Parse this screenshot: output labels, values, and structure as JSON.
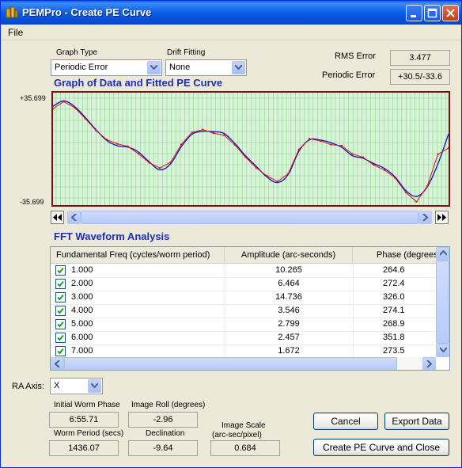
{
  "window": {
    "title": "PEMPro - Create PE Curve"
  },
  "menu": {
    "file": "File"
  },
  "controls": {
    "graph_type_label": "Graph Type",
    "graph_type_value": "Periodic Error",
    "drift_label": "Drift Fitting",
    "drift_value": "None",
    "rms_label": "RMS Error",
    "rms_value": "3.477",
    "pe_label": "Periodic Error",
    "pe_value": "+30.5/-33.6"
  },
  "graph": {
    "title": "Graph of Data and Fitted PE Curve",
    "y_max_label": "+35.699",
    "y_min_label": "-35.699",
    "colors": {
      "background": "#d8f4d8",
      "grid": "#8fd08f",
      "data": "#e01010",
      "fit": "#1010c0",
      "border": "#7a1010"
    }
  },
  "chart_data": {
    "type": "line",
    "title": "Graph of Data and Fitted PE Curve",
    "ylim": [
      -35.699,
      35.699
    ],
    "series": [
      {
        "name": "fit",
        "values": [
          27.0,
          30.5,
          27.0,
          20.1,
          12.3,
          5.5,
          2.0,
          1.1,
          -2.0,
          -8.2,
          -13.3,
          -9.5,
          1.4,
          9.3,
          11.1,
          10.9,
          9.8,
          3.5,
          -4.3,
          -11.0,
          -17.8,
          -21.4,
          -16.3,
          -1.5,
          5.8,
          5.6,
          3.9,
          1.0,
          -4.3,
          -6.0,
          -9.3,
          -12.4,
          -17.8,
          -26.4,
          -30.2,
          -24.2,
          -9.6,
          9.5
        ]
      },
      {
        "name": "data",
        "values": [
          25.5,
          30.0,
          26.3,
          19.4,
          11.8,
          6.0,
          3.2,
          1.6,
          -3.1,
          -8.8,
          -12.1,
          -8.6,
          2.8,
          10.4,
          12.2,
          10.0,
          8.7,
          2.6,
          -5.2,
          -12.0,
          -17.1,
          -20.7,
          -15.8,
          -0.4,
          6.4,
          5.1,
          2.7,
          2.0,
          -3.2,
          -5.4,
          -10.2,
          -13.4,
          -18.4,
          -27.6,
          -33.6,
          -23.8,
          -3.4,
          0.5
        ]
      }
    ]
  },
  "fft": {
    "title": "FFT Waveform Analysis",
    "columns": [
      "Fundamental Freq (cycles/worm period)",
      "Amplitude (arc-seconds)",
      "Phase (degrees)"
    ],
    "rows": [
      {
        "checked": true,
        "freq": "1.000",
        "amp": "10.265",
        "phase": "264.6"
      },
      {
        "checked": true,
        "freq": "2.000",
        "amp": "6.464",
        "phase": "272.4"
      },
      {
        "checked": true,
        "freq": "3.000",
        "amp": "14.736",
        "phase": "326.0"
      },
      {
        "checked": true,
        "freq": "4.000",
        "amp": "3.546",
        "phase": "274.1"
      },
      {
        "checked": true,
        "freq": "5.000",
        "amp": "2.799",
        "phase": "268.9"
      },
      {
        "checked": true,
        "freq": "6.000",
        "amp": "2.457",
        "phase": "351.8"
      },
      {
        "checked": true,
        "freq": "7.000",
        "amp": "1.672",
        "phase": "273.5"
      }
    ]
  },
  "bottom": {
    "ra_axis_label": "RA Axis:",
    "ra_axis_value": "X",
    "worm_phase_label": "Initial Worm Phase",
    "worm_phase_value": "6:55.71",
    "image_roll_label": "Image Roll (degrees)",
    "image_roll_value": "-2.96",
    "worm_period_label": "Worm Period (secs)",
    "worm_period_value": "1436.07",
    "declination_label": "Declination",
    "declination_value": "-9.64",
    "image_scale_label1": "Image Scale",
    "image_scale_label2": "(arc-sec/pixel)",
    "image_scale_value": "0.684"
  },
  "buttons": {
    "cancel": "Cancel",
    "export": "Export Data",
    "create": "Create PE Curve and Close"
  }
}
